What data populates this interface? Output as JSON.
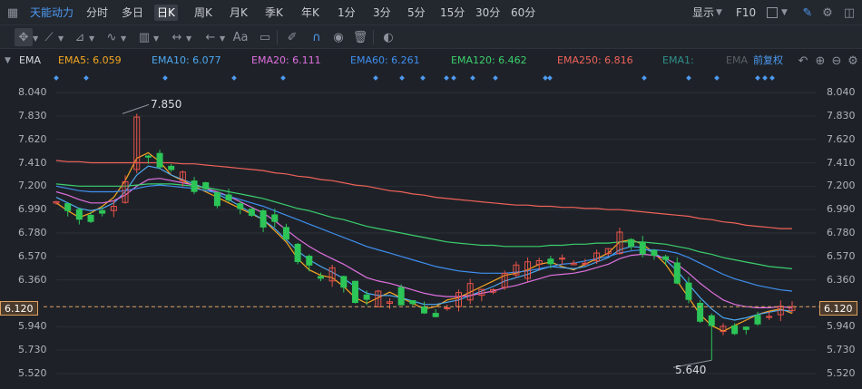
{
  "period_bar": {
    "title": "天能动力",
    "items": [
      "分时",
      "多日",
      "日K",
      "周K",
      "月K",
      "季K",
      "年K",
      "1分",
      "3分",
      "5分",
      "15分",
      "30分",
      "60分"
    ],
    "active": "日K",
    "right_items": [
      "显示",
      "F10"
    ]
  },
  "toolbar": {
    "icons": [
      "crosshair-icon",
      "line-icon",
      "ray-icon",
      "wave-icon",
      "measure-icon",
      "range-icon",
      "arrow-left-icon",
      "text-icon",
      "comment-icon",
      "pen-icon",
      "magnet-icon",
      "eye-icon",
      "trash-icon",
      "toggle-icon"
    ],
    "text_tool_label": "Aa"
  },
  "ema_bar": {
    "name": "EMA",
    "items": [
      {
        "label": "EMA5: 6.059",
        "color": "#f5a623"
      },
      {
        "label": "EMA10: 6.077",
        "color": "#4ea8f0"
      },
      {
        "label": "EMA20: 6.111",
        "color": "#e070e0"
      },
      {
        "label": "EMA60: 6.261",
        "color": "#3f8ff0"
      },
      {
        "label": "EMA120: 6.462",
        "color": "#3ccf6e"
      },
      {
        "label": "EMA250: 6.816",
        "color": "#f0625a"
      },
      {
        "label": "EMA1:",
        "color": "#2f8f8a"
      },
      {
        "label": "EMA",
        "color": "#5a5f66"
      }
    ],
    "adjust_label": "前复权"
  },
  "current_price": "6.120",
  "annotations": {
    "high": "7.850",
    "low": "5.640"
  },
  "chart_data": {
    "type": "candlestick",
    "y_ticks": [
      "8.040",
      "7.830",
      "7.620",
      "7.410",
      "7.200",
      "6.990",
      "6.780",
      "6.570",
      "6.360",
      "6.120",
      "5.940",
      "5.730",
      "5.520"
    ],
    "ylim": [
      5.52,
      8.04
    ],
    "high": 7.85,
    "low": 5.64,
    "last": 6.12,
    "series": [
      {
        "name": "EMA5",
        "color": "#f5a623",
        "values": [
          7.05,
          6.98,
          6.92,
          6.96,
          7.02,
          7.1,
          7.25,
          7.45,
          7.5,
          7.42,
          7.3,
          7.25,
          7.2,
          7.15,
          7.1,
          7.05,
          7.0,
          6.95,
          6.9,
          6.8,
          6.7,
          6.55,
          6.45,
          6.4,
          6.38,
          6.3,
          6.2,
          6.15,
          6.2,
          6.25,
          6.2,
          6.15,
          6.1,
          6.12,
          6.18,
          6.2,
          6.25,
          6.3,
          6.35,
          6.4,
          6.42,
          6.45,
          6.5,
          6.52,
          6.48,
          6.45,
          6.5,
          6.55,
          6.6,
          6.7,
          6.72,
          6.68,
          6.6,
          6.5,
          6.35,
          6.2,
          6.05,
          5.95,
          5.9,
          5.95,
          6.0,
          6.05,
          6.08,
          6.1,
          6.06
        ]
      },
      {
        "name": "EMA10",
        "color": "#4ea8f0",
        "values": [
          7.1,
          7.05,
          7.0,
          6.98,
          7.0,
          7.05,
          7.15,
          7.3,
          7.38,
          7.36,
          7.3,
          7.26,
          7.22,
          7.18,
          7.13,
          7.08,
          7.02,
          6.96,
          6.9,
          6.82,
          6.72,
          6.62,
          6.54,
          6.48,
          6.43,
          6.37,
          6.3,
          6.24,
          6.22,
          6.22,
          6.2,
          6.17,
          6.14,
          6.14,
          6.16,
          6.18,
          6.22,
          6.26,
          6.3,
          6.35,
          6.38,
          6.41,
          6.45,
          6.48,
          6.47,
          6.46,
          6.48,
          6.52,
          6.56,
          6.63,
          6.66,
          6.65,
          6.6,
          6.54,
          6.44,
          6.32,
          6.2,
          6.1,
          6.02,
          6.0,
          6.02,
          6.05,
          6.07,
          6.09,
          6.08
        ]
      },
      {
        "name": "EMA20",
        "color": "#e070e0",
        "values": [
          7.15,
          7.12,
          7.08,
          7.05,
          7.05,
          7.07,
          7.12,
          7.2,
          7.26,
          7.27,
          7.25,
          7.23,
          7.21,
          7.18,
          7.15,
          7.11,
          7.06,
          7.01,
          6.96,
          6.89,
          6.81,
          6.73,
          6.66,
          6.6,
          6.55,
          6.5,
          6.44,
          6.38,
          6.35,
          6.33,
          6.3,
          6.27,
          6.24,
          6.22,
          6.21,
          6.21,
          6.22,
          6.24,
          6.26,
          6.29,
          6.31,
          6.34,
          6.37,
          6.4,
          6.41,
          6.42,
          6.44,
          6.47,
          6.5,
          6.55,
          6.58,
          6.59,
          6.58,
          6.55,
          6.5,
          6.42,
          6.33,
          6.25,
          6.18,
          6.14,
          6.12,
          6.11,
          6.11,
          6.12,
          6.11
        ]
      },
      {
        "name": "EMA60",
        "color": "#3f8ff0",
        "values": [
          7.2,
          7.18,
          7.16,
          7.15,
          7.15,
          7.15,
          7.16,
          7.18,
          7.2,
          7.21,
          7.2,
          7.19,
          7.18,
          7.16,
          7.14,
          7.11,
          7.08,
          7.05,
          7.02,
          6.98,
          6.94,
          6.9,
          6.86,
          6.82,
          6.78,
          6.74,
          6.7,
          6.66,
          6.63,
          6.6,
          6.57,
          6.54,
          6.51,
          6.48,
          6.46,
          6.44,
          6.43,
          6.42,
          6.42,
          6.42,
          6.43,
          6.44,
          6.46,
          6.48,
          6.5,
          6.51,
          6.53,
          6.55,
          6.57,
          6.6,
          6.62,
          6.63,
          6.63,
          6.62,
          6.6,
          6.56,
          6.51,
          6.46,
          6.41,
          6.37,
          6.34,
          6.31,
          6.29,
          6.27,
          6.26
        ]
      },
      {
        "name": "EMA120",
        "color": "#3ccf6e",
        "values": [
          7.22,
          7.21,
          7.2,
          7.2,
          7.2,
          7.2,
          7.2,
          7.21,
          7.22,
          7.22,
          7.22,
          7.21,
          7.2,
          7.19,
          7.17,
          7.15,
          7.13,
          7.11,
          7.09,
          7.06,
          7.03,
          7.0,
          6.98,
          6.95,
          6.92,
          6.9,
          6.87,
          6.84,
          6.82,
          6.8,
          6.78,
          6.76,
          6.74,
          6.72,
          6.7,
          6.69,
          6.68,
          6.67,
          6.67,
          6.66,
          6.66,
          6.66,
          6.66,
          6.67,
          6.67,
          6.68,
          6.68,
          6.69,
          6.69,
          6.7,
          6.7,
          6.7,
          6.69,
          6.68,
          6.66,
          6.64,
          6.61,
          6.59,
          6.56,
          6.54,
          6.52,
          6.5,
          6.48,
          6.47,
          6.46
        ]
      },
      {
        "name": "EMA250",
        "color": "#f0625a",
        "values": [
          7.43,
          7.42,
          7.42,
          7.41,
          7.41,
          7.41,
          7.41,
          7.41,
          7.41,
          7.41,
          7.41,
          7.4,
          7.4,
          7.39,
          7.38,
          7.37,
          7.36,
          7.35,
          7.34,
          7.32,
          7.31,
          7.29,
          7.28,
          7.26,
          7.25,
          7.23,
          7.21,
          7.2,
          7.18,
          7.16,
          7.15,
          7.13,
          7.12,
          7.1,
          7.09,
          7.08,
          7.07,
          7.06,
          7.05,
          7.04,
          7.03,
          7.03,
          7.02,
          7.02,
          7.01,
          7.01,
          7.0,
          7.0,
          6.99,
          6.99,
          6.98,
          6.97,
          6.96,
          6.95,
          6.94,
          6.93,
          6.91,
          6.9,
          6.88,
          6.87,
          6.85,
          6.84,
          6.83,
          6.82,
          6.82
        ]
      }
    ]
  }
}
